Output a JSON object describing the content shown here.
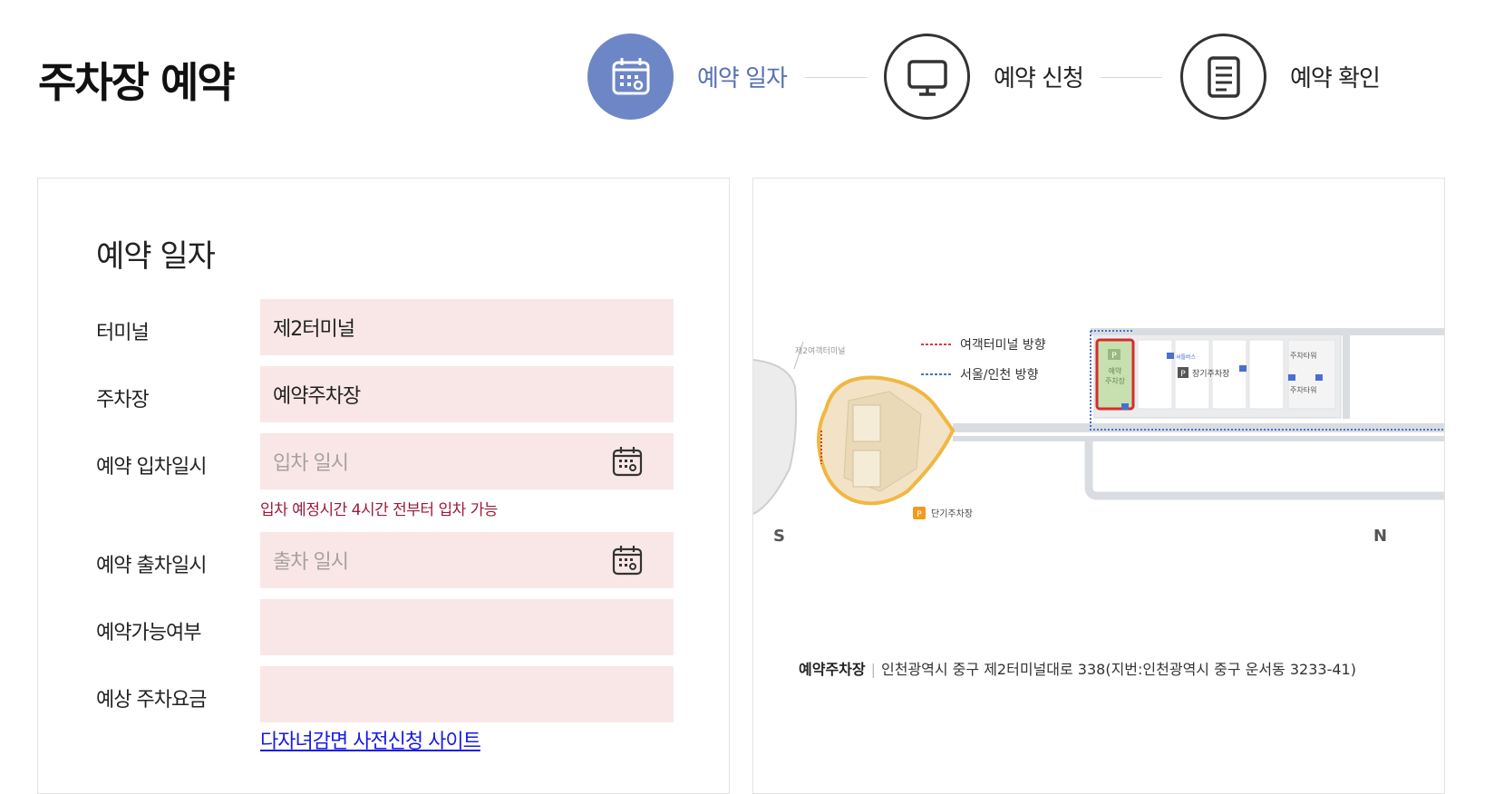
{
  "page": {
    "title": "주차장 예약"
  },
  "steps": [
    {
      "label": "예약 일자",
      "icon": "calendar-icon",
      "active": true
    },
    {
      "label": "예약 신청",
      "icon": "monitor-icon",
      "active": false
    },
    {
      "label": "예약 확인",
      "icon": "document-icon",
      "active": false
    }
  ],
  "colors": {
    "accent": "#6d86c5",
    "field_bg": "#f9e7e7",
    "hint": "#9b1b3b",
    "link": "#1a1ae6"
  },
  "form": {
    "title": "예약 일자",
    "terminal": {
      "label": "터미널",
      "value": "제2터미널"
    },
    "parking": {
      "label": "주차장",
      "value": "예약주차장"
    },
    "entry": {
      "label": "예약 입차일시",
      "placeholder": "입차 일시",
      "hint": "입차 예정시간 4시간 전부터 입차 가능"
    },
    "exit": {
      "label": "예약 출차일시",
      "placeholder": "출차 일시"
    },
    "availability": {
      "label": "예약가능여부",
      "value": ""
    },
    "fee": {
      "label": "예상 주차요금",
      "value": ""
    },
    "link_text": "다자녀감면 사전신청 사이트"
  },
  "map": {
    "legend": {
      "terminal_direction": "여객터미널 방향",
      "seoul_direction": "서울/인천 방향"
    },
    "labels": {
      "terminal2": "제2여객터미널",
      "reserved_parking": [
        "예약",
        "주차장"
      ],
      "long_term": "장기주차장",
      "short_term": "단기주차장",
      "parking_tower": "주차타워",
      "shuttle": "셔틀버스",
      "p_mark": "P"
    },
    "compass": {
      "south": "S",
      "north": "N"
    },
    "address": {
      "name": "예약주차장",
      "text": "인천광역시 중구 제2터미널대로 338(지번:인천광역시 중구 운서동 3233-41)"
    }
  }
}
